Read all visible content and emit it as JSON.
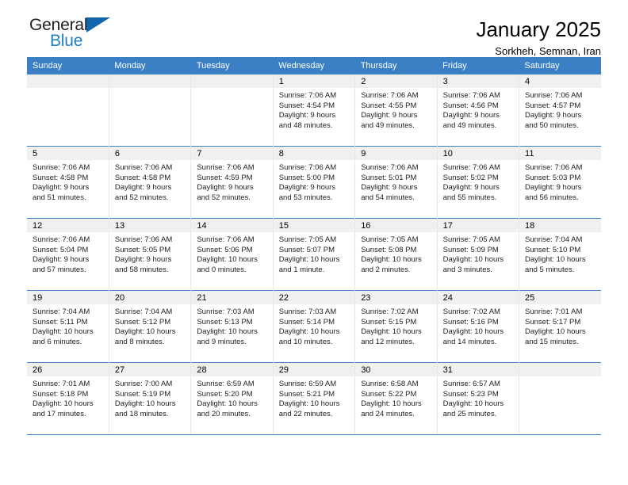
{
  "logo": {
    "text_top": "General",
    "text_bottom": "Blue",
    "flag_icon": "triangle-flag-icon",
    "blue": "#1266ab",
    "text_blue": "#1f7ec4",
    "text_dark": "#231f20"
  },
  "header": {
    "title": "January 2025",
    "subtitle": "Sorkheh, Semnan, Iran"
  },
  "theme": {
    "header_bg": "#3b7fc4",
    "daynum_bg": "#f0f0f0",
    "grid_line": "#e8e8e8"
  },
  "weekday_headers": [
    "Sunday",
    "Monday",
    "Tuesday",
    "Wednesday",
    "Thursday",
    "Friday",
    "Saturday"
  ],
  "weeks": [
    [
      {
        "day": "",
        "sunrise": "",
        "sunset": "",
        "daylight1": "",
        "daylight2": ""
      },
      {
        "day": "",
        "sunrise": "",
        "sunset": "",
        "daylight1": "",
        "daylight2": ""
      },
      {
        "day": "",
        "sunrise": "",
        "sunset": "",
        "daylight1": "",
        "daylight2": ""
      },
      {
        "day": "1",
        "sunrise": "Sunrise: 7:06 AM",
        "sunset": "Sunset: 4:54 PM",
        "daylight1": "Daylight: 9 hours",
        "daylight2": "and 48 minutes."
      },
      {
        "day": "2",
        "sunrise": "Sunrise: 7:06 AM",
        "sunset": "Sunset: 4:55 PM",
        "daylight1": "Daylight: 9 hours",
        "daylight2": "and 49 minutes."
      },
      {
        "day": "3",
        "sunrise": "Sunrise: 7:06 AM",
        "sunset": "Sunset: 4:56 PM",
        "daylight1": "Daylight: 9 hours",
        "daylight2": "and 49 minutes."
      },
      {
        "day": "4",
        "sunrise": "Sunrise: 7:06 AM",
        "sunset": "Sunset: 4:57 PM",
        "daylight1": "Daylight: 9 hours",
        "daylight2": "and 50 minutes."
      }
    ],
    [
      {
        "day": "5",
        "sunrise": "Sunrise: 7:06 AM",
        "sunset": "Sunset: 4:58 PM",
        "daylight1": "Daylight: 9 hours",
        "daylight2": "and 51 minutes."
      },
      {
        "day": "6",
        "sunrise": "Sunrise: 7:06 AM",
        "sunset": "Sunset: 4:58 PM",
        "daylight1": "Daylight: 9 hours",
        "daylight2": "and 52 minutes."
      },
      {
        "day": "7",
        "sunrise": "Sunrise: 7:06 AM",
        "sunset": "Sunset: 4:59 PM",
        "daylight1": "Daylight: 9 hours",
        "daylight2": "and 52 minutes."
      },
      {
        "day": "8",
        "sunrise": "Sunrise: 7:06 AM",
        "sunset": "Sunset: 5:00 PM",
        "daylight1": "Daylight: 9 hours",
        "daylight2": "and 53 minutes."
      },
      {
        "day": "9",
        "sunrise": "Sunrise: 7:06 AM",
        "sunset": "Sunset: 5:01 PM",
        "daylight1": "Daylight: 9 hours",
        "daylight2": "and 54 minutes."
      },
      {
        "day": "10",
        "sunrise": "Sunrise: 7:06 AM",
        "sunset": "Sunset: 5:02 PM",
        "daylight1": "Daylight: 9 hours",
        "daylight2": "and 55 minutes."
      },
      {
        "day": "11",
        "sunrise": "Sunrise: 7:06 AM",
        "sunset": "Sunset: 5:03 PM",
        "daylight1": "Daylight: 9 hours",
        "daylight2": "and 56 minutes."
      }
    ],
    [
      {
        "day": "12",
        "sunrise": "Sunrise: 7:06 AM",
        "sunset": "Sunset: 5:04 PM",
        "daylight1": "Daylight: 9 hours",
        "daylight2": "and 57 minutes."
      },
      {
        "day": "13",
        "sunrise": "Sunrise: 7:06 AM",
        "sunset": "Sunset: 5:05 PM",
        "daylight1": "Daylight: 9 hours",
        "daylight2": "and 58 minutes."
      },
      {
        "day": "14",
        "sunrise": "Sunrise: 7:06 AM",
        "sunset": "Sunset: 5:06 PM",
        "daylight1": "Daylight: 10 hours",
        "daylight2": "and 0 minutes."
      },
      {
        "day": "15",
        "sunrise": "Sunrise: 7:05 AM",
        "sunset": "Sunset: 5:07 PM",
        "daylight1": "Daylight: 10 hours",
        "daylight2": "and 1 minute."
      },
      {
        "day": "16",
        "sunrise": "Sunrise: 7:05 AM",
        "sunset": "Sunset: 5:08 PM",
        "daylight1": "Daylight: 10 hours",
        "daylight2": "and 2 minutes."
      },
      {
        "day": "17",
        "sunrise": "Sunrise: 7:05 AM",
        "sunset": "Sunset: 5:09 PM",
        "daylight1": "Daylight: 10 hours",
        "daylight2": "and 3 minutes."
      },
      {
        "day": "18",
        "sunrise": "Sunrise: 7:04 AM",
        "sunset": "Sunset: 5:10 PM",
        "daylight1": "Daylight: 10 hours",
        "daylight2": "and 5 minutes."
      }
    ],
    [
      {
        "day": "19",
        "sunrise": "Sunrise: 7:04 AM",
        "sunset": "Sunset: 5:11 PM",
        "daylight1": "Daylight: 10 hours",
        "daylight2": "and 6 minutes."
      },
      {
        "day": "20",
        "sunrise": "Sunrise: 7:04 AM",
        "sunset": "Sunset: 5:12 PM",
        "daylight1": "Daylight: 10 hours",
        "daylight2": "and 8 minutes."
      },
      {
        "day": "21",
        "sunrise": "Sunrise: 7:03 AM",
        "sunset": "Sunset: 5:13 PM",
        "daylight1": "Daylight: 10 hours",
        "daylight2": "and 9 minutes."
      },
      {
        "day": "22",
        "sunrise": "Sunrise: 7:03 AM",
        "sunset": "Sunset: 5:14 PM",
        "daylight1": "Daylight: 10 hours",
        "daylight2": "and 10 minutes."
      },
      {
        "day": "23",
        "sunrise": "Sunrise: 7:02 AM",
        "sunset": "Sunset: 5:15 PM",
        "daylight1": "Daylight: 10 hours",
        "daylight2": "and 12 minutes."
      },
      {
        "day": "24",
        "sunrise": "Sunrise: 7:02 AM",
        "sunset": "Sunset: 5:16 PM",
        "daylight1": "Daylight: 10 hours",
        "daylight2": "and 14 minutes."
      },
      {
        "day": "25",
        "sunrise": "Sunrise: 7:01 AM",
        "sunset": "Sunset: 5:17 PM",
        "daylight1": "Daylight: 10 hours",
        "daylight2": "and 15 minutes."
      }
    ],
    [
      {
        "day": "26",
        "sunrise": "Sunrise: 7:01 AM",
        "sunset": "Sunset: 5:18 PM",
        "daylight1": "Daylight: 10 hours",
        "daylight2": "and 17 minutes."
      },
      {
        "day": "27",
        "sunrise": "Sunrise: 7:00 AM",
        "sunset": "Sunset: 5:19 PM",
        "daylight1": "Daylight: 10 hours",
        "daylight2": "and 18 minutes."
      },
      {
        "day": "28",
        "sunrise": "Sunrise: 6:59 AM",
        "sunset": "Sunset: 5:20 PM",
        "daylight1": "Daylight: 10 hours",
        "daylight2": "and 20 minutes."
      },
      {
        "day": "29",
        "sunrise": "Sunrise: 6:59 AM",
        "sunset": "Sunset: 5:21 PM",
        "daylight1": "Daylight: 10 hours",
        "daylight2": "and 22 minutes."
      },
      {
        "day": "30",
        "sunrise": "Sunrise: 6:58 AM",
        "sunset": "Sunset: 5:22 PM",
        "daylight1": "Daylight: 10 hours",
        "daylight2": "and 24 minutes."
      },
      {
        "day": "31",
        "sunrise": "Sunrise: 6:57 AM",
        "sunset": "Sunset: 5:23 PM",
        "daylight1": "Daylight: 10 hours",
        "daylight2": "and 25 minutes."
      },
      {
        "day": "",
        "sunrise": "",
        "sunset": "",
        "daylight1": "",
        "daylight2": ""
      }
    ]
  ]
}
